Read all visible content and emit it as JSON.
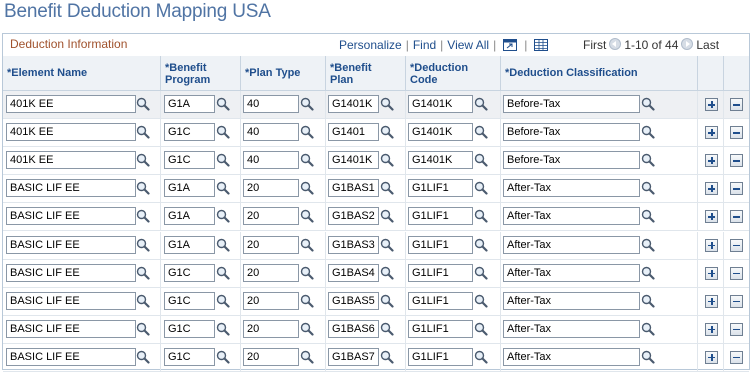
{
  "page": {
    "title": "Benefit Deduction Mapping USA"
  },
  "grid": {
    "title": "Deduction Information",
    "nav": {
      "personalize": "Personalize",
      "find": "Find",
      "view_all": "View All",
      "first": "First",
      "range": "1-10 of 44",
      "last": "Last",
      "sep": "|"
    },
    "columns": [
      {
        "label": "*Element Name"
      },
      {
        "label": "*Benefit Program"
      },
      {
        "label": "*Plan Type"
      },
      {
        "label": "*Benefit Plan"
      },
      {
        "label": "*Deduction Code"
      },
      {
        "label": "*Deduction Classification"
      }
    ],
    "rows": [
      {
        "element": "401K EE",
        "program": "G1A",
        "plan_type": "40",
        "plan": "G1401K",
        "code": "G1401K",
        "classification": "Before-Tax"
      },
      {
        "element": "401K EE",
        "program": "G1C",
        "plan_type": "40",
        "plan": "G1401",
        "code": "G1401K",
        "classification": "Before-Tax"
      },
      {
        "element": "401K EE",
        "program": "G1C",
        "plan_type": "40",
        "plan": "G1401K",
        "code": "G1401K",
        "classification": "Before-Tax"
      },
      {
        "element": "BASIC LIF EE",
        "program": "G1A",
        "plan_type": "20",
        "plan": "G1BAS1",
        "code": "G1LIF1",
        "classification": "After-Tax"
      },
      {
        "element": "BASIC LIF EE",
        "program": "G1A",
        "plan_type": "20",
        "plan": "G1BAS2",
        "code": "G1LIF1",
        "classification": "After-Tax"
      },
      {
        "element": "BASIC LIF EE",
        "program": "G1A",
        "plan_type": "20",
        "plan": "G1BAS3",
        "code": "G1LIF1",
        "classification": "After-Tax"
      },
      {
        "element": "BASIC LIF EE",
        "program": "G1C",
        "plan_type": "20",
        "plan": "G1BAS4",
        "code": "G1LIF1",
        "classification": "After-Tax"
      },
      {
        "element": "BASIC LIF EE",
        "program": "G1C",
        "plan_type": "20",
        "plan": "G1BAS5",
        "code": "G1LIF1",
        "classification": "After-Tax"
      },
      {
        "element": "BASIC LIF EE",
        "program": "G1C",
        "plan_type": "20",
        "plan": "G1BAS6",
        "code": "G1LIF1",
        "classification": "After-Tax"
      },
      {
        "element": "BASIC LIF EE",
        "program": "G1C",
        "plan_type": "20",
        "plan": "G1BAS7",
        "code": "G1LIF1",
        "classification": "After-Tax"
      }
    ]
  },
  "icons": {
    "lookup": "magnifier-icon",
    "add": "plus-icon",
    "delete": "minus-icon",
    "zoom": "zoom-grid-icon",
    "download": "spreadsheet-icon"
  },
  "colors": {
    "title": "#5074a4",
    "link": "#1f4e8c",
    "grid_title": "#a0522d",
    "header_bg": "#eef2f6"
  }
}
